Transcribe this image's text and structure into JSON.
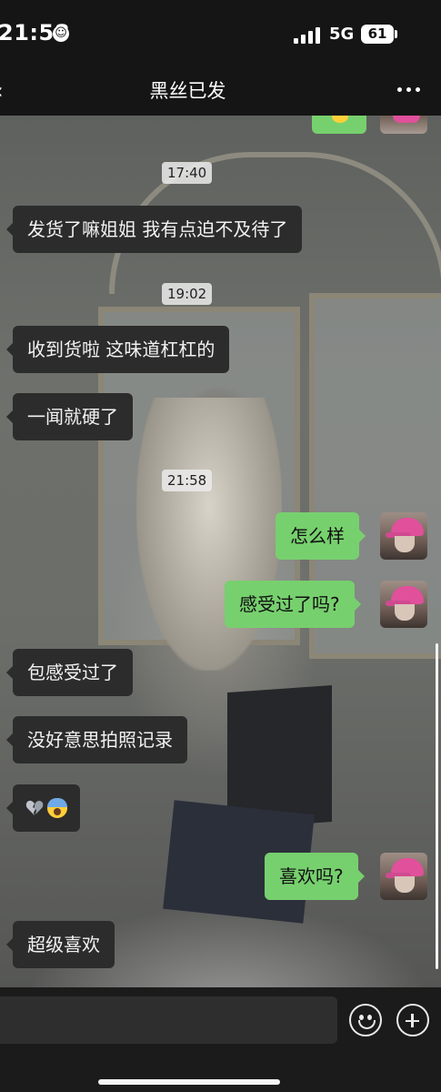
{
  "status_bar": {
    "time": "21:58",
    "time_icon": "smile-icon",
    "signal_icon": "signal-bars-icon",
    "network": "5G",
    "battery": "61"
  },
  "nav": {
    "title": "黑丝已发",
    "back_icon": "back-chevron-icon",
    "more_icon": "more-dots-icon"
  },
  "colors": {
    "outgoing_bubble": "#77d06e",
    "incoming_bubble": "#2c2c2c",
    "timestamp_bg": "#ebebeb"
  },
  "messages": {
    "t1": "17:40",
    "m1": "发货了嘛姐姐 我有点迫不及待了",
    "t2": "19:02",
    "m2": "收到货啦 这味道杠杠的",
    "m3": "一闻就硬了",
    "t3": "21:58",
    "m4": "怎么样",
    "m5": "感受过了吗?",
    "m6": "包感受过了",
    "m7": "没好意思拍照记录",
    "m8_icons": [
      "broken-heart-emoji",
      "screaming-face-emoji"
    ],
    "m9": "喜欢吗?",
    "m10": "超级喜欢"
  },
  "input": {
    "placeholder": "",
    "emoji_icon": "emoji-icon",
    "plus_icon": "plus-icon"
  }
}
